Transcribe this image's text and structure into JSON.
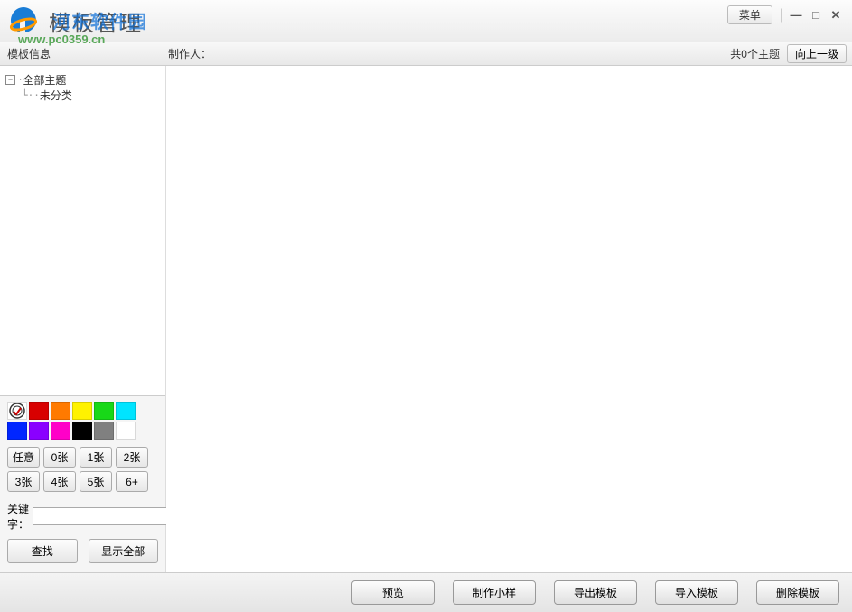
{
  "titlebar": {
    "title": "模板管理",
    "menu_label": "菜单",
    "watermark_top": "河东软件园",
    "watermark_bottom": "www.pc0359.cn"
  },
  "infobar": {
    "template_info_label": "模板信息",
    "author_label": "制作人：",
    "theme_count": "共0个主题",
    "up_level_label": "向上一级"
  },
  "tree": {
    "root": "全部主题",
    "child": "未分类"
  },
  "filter": {
    "colors": [
      "#d80000",
      "#ff7a00",
      "#fff200",
      "#18d818",
      "#00e4ff",
      "#0026ff",
      "#8a00ff",
      "#ff00c8",
      "#000000",
      "#808080",
      "#ffffff"
    ],
    "count_labels": [
      "任意",
      "0张",
      "1张",
      "2张",
      "3张",
      "4张",
      "5张",
      "6+"
    ],
    "keyword_label": "关键字：",
    "keyword_value": "",
    "search_label": "查找",
    "showall_label": "显示全部"
  },
  "bottom": {
    "preview": "预览",
    "make_sample": "制作小样",
    "export": "导出模板",
    "import": "导入模板",
    "delete": "删除模板"
  }
}
